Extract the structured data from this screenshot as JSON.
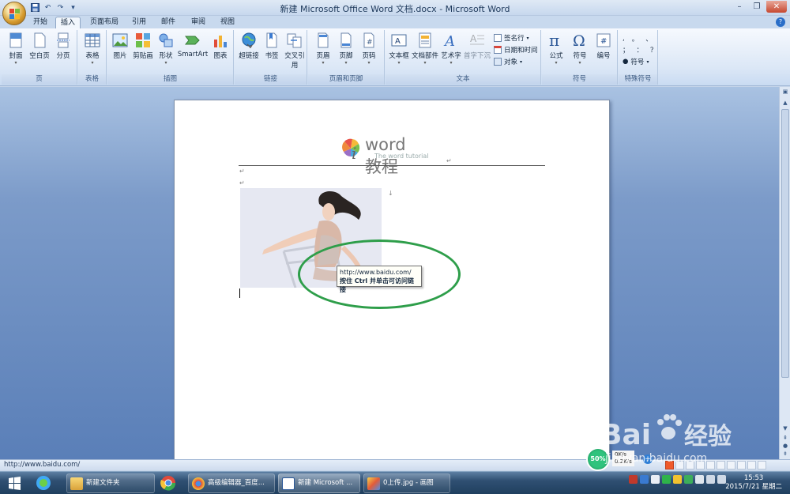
{
  "window": {
    "title": "新建 Microsoft Office Word 文档.docx - Microsoft Word"
  },
  "qat": [
    "save",
    "undo",
    "redo",
    "customize"
  ],
  "tabs": [
    {
      "label": "开始"
    },
    {
      "label": "插入",
      "active": true
    },
    {
      "label": "页面布局"
    },
    {
      "label": "引用"
    },
    {
      "label": "邮件"
    },
    {
      "label": "审阅"
    },
    {
      "label": "视图"
    }
  ],
  "ribbon": {
    "groups": [
      {
        "label": "页",
        "buttons": [
          "封面",
          "空白页",
          "分页"
        ]
      },
      {
        "label": "表格",
        "buttons": [
          "表格"
        ]
      },
      {
        "label": "插图",
        "buttons": [
          "图片",
          "剪贴画",
          "形状",
          "SmartArt",
          "图表"
        ]
      },
      {
        "label": "链接",
        "buttons": [
          "超链接",
          "书签",
          "交叉引用"
        ]
      },
      {
        "label": "页眉和页脚",
        "buttons": [
          "页眉",
          "页脚",
          "页码"
        ]
      },
      {
        "label": "文本",
        "buttons": [
          "文本框",
          "文档部件",
          "艺术字",
          "首字下沉"
        ],
        "small": [
          "签名行",
          "日期和时间",
          "对象"
        ]
      },
      {
        "label": "符号",
        "buttons": [
          "公式",
          "符号",
          "编号"
        ]
      },
      {
        "label": "特殊符号",
        "small": [
          "符号"
        ]
      }
    ]
  },
  "document": {
    "logo_word": "word教程",
    "logo_sub": "The word tutorial",
    "tooltip_url": "http://www.baidu.com/",
    "tooltip_hint": "按住 Ctrl 并单击可访问链接"
  },
  "status": {
    "text": "http://www.baidu.com/"
  },
  "speed": {
    "percent": "50%",
    "up": "0K/s",
    "down": "0.2K/s"
  },
  "taskbar": {
    "items": [
      {
        "label": "新建文件夹"
      },
      {
        "label": "高级编辑器_百度..."
      },
      {
        "label": "新建 Microsoft ..."
      },
      {
        "label": "0上传.jpg - 画图"
      }
    ],
    "time": "15:53",
    "date": "2015/7/21 星期二"
  },
  "watermark": {
    "brand": "Bai",
    "brand2": "经验",
    "url": "jingyan.baidu.com"
  },
  "colors": {
    "highlight_ellipse": "#2e9e4a",
    "ribbon_bg": "#dbe7f6",
    "doc_bg": "#7c9bc9"
  }
}
